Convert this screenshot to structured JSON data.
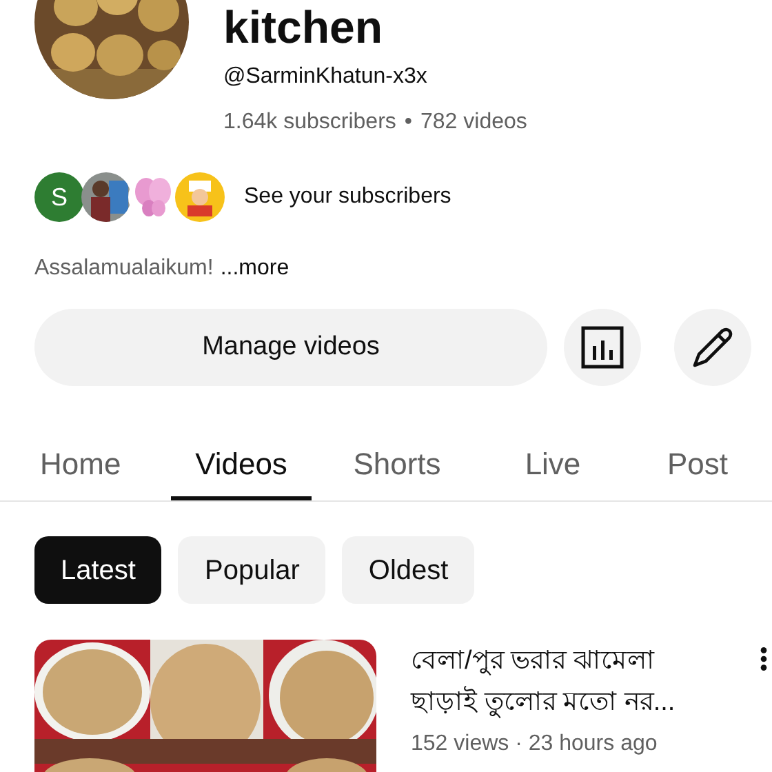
{
  "channel": {
    "title": "kitchen",
    "handle": "@SarminKhatun-x3x",
    "subscribers": "1.64k subscribers",
    "separator": "•",
    "videos": "782 videos"
  },
  "subscribers_row": {
    "avatars": [
      {
        "kind": "letter",
        "letter": "S",
        "color": "#2e7d32"
      },
      {
        "kind": "picture"
      },
      {
        "kind": "picture"
      },
      {
        "kind": "picture"
      }
    ],
    "label": "See your subscribers"
  },
  "description": {
    "text": "Assalamualaikum!",
    "more": "...more"
  },
  "actions": {
    "manage": "Manage videos"
  },
  "tabs": [
    {
      "label": "Home",
      "selected": false
    },
    {
      "label": "Videos",
      "selected": true
    },
    {
      "label": "Shorts",
      "selected": false
    },
    {
      "label": "Live",
      "selected": false
    },
    {
      "label": "Post",
      "selected": false
    }
  ],
  "filters": [
    {
      "label": "Latest",
      "selected": true
    },
    {
      "label": "Popular",
      "selected": false
    },
    {
      "label": "Oldest",
      "selected": false
    }
  ],
  "videos": [
    {
      "title": "বেলা/পুর ভরার ঝামেলা ছাড়াই তুলোর মতো নর...",
      "meta": "152 views · 23 hours ago"
    }
  ]
}
